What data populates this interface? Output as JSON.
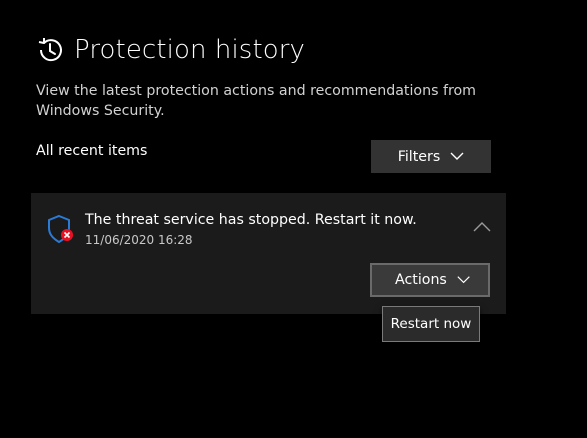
{
  "page": {
    "title": "Protection history",
    "description": "View the latest protection actions and recommendations from Windows Security.",
    "filter_label": "All recent items",
    "filters_button": "Filters"
  },
  "item": {
    "title": "The threat service has stopped. Restart it now.",
    "timestamp": "11/06/2020 16:28",
    "actions_button": "Actions",
    "menu": [
      "Restart now"
    ]
  },
  "colors": {
    "background": "#000000",
    "card": "#1b1b1b",
    "button": "#333333",
    "shield_blue": "#2b7bd6",
    "error_red": "#e81123"
  },
  "icons": {
    "title": "history-icon",
    "item": "shield-error-icon",
    "collapse": "chevron-up-icon",
    "dropdown": "chevron-down-icon"
  }
}
